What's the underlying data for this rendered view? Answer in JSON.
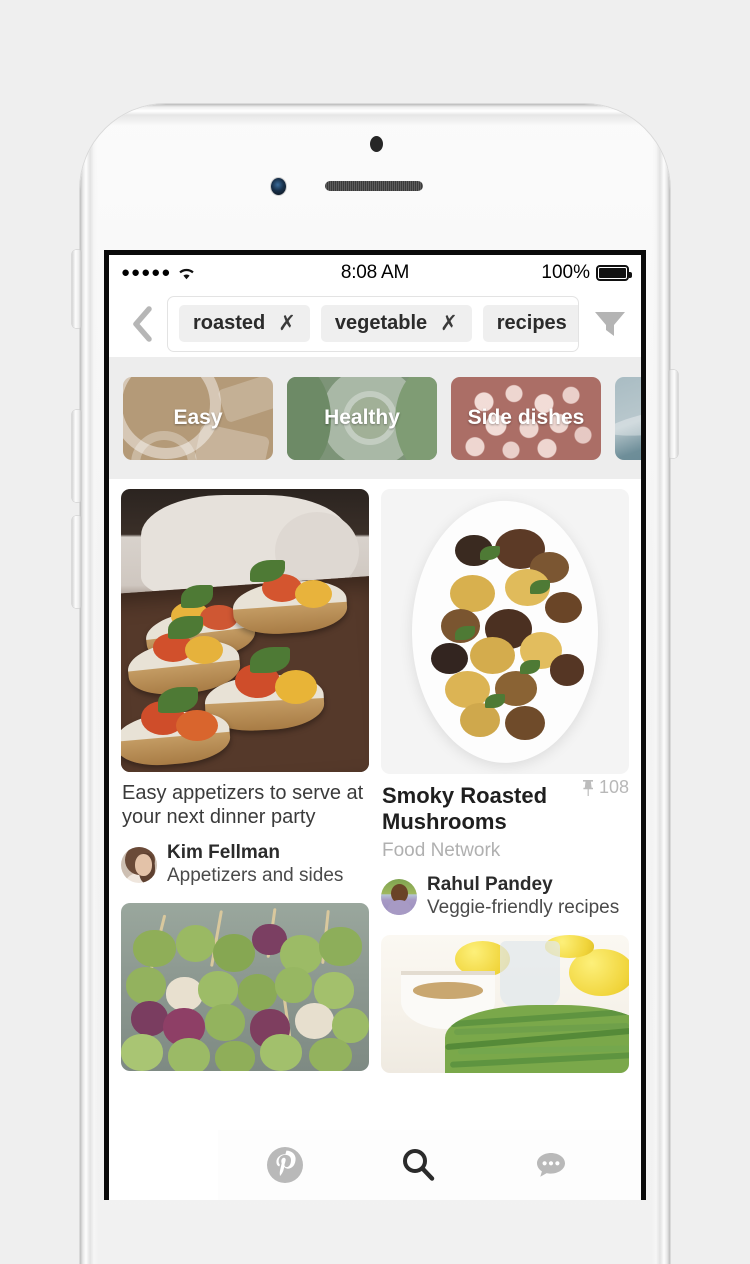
{
  "device": {
    "name": "iphone-white-silver",
    "body_color": "#f4f4f4",
    "bezel_color": "#ffffff"
  },
  "status_bar": {
    "signal_icon": "signal-dots-icon",
    "signal_dots": "●●●●●",
    "wifi_icon": "wifi-icon",
    "time": "8:08 AM",
    "battery_percent": "100%",
    "battery_icon": "battery-full-icon"
  },
  "search_header": {
    "back_icon": "chevron-left-icon",
    "filter_icon": "filter-funnel-icon",
    "chips": [
      {
        "label": "roasted",
        "remove_icon": "close-x-icon"
      },
      {
        "label": "vegetable",
        "remove_icon": "close-x-icon"
      },
      {
        "label": "recipes",
        "remove_icon": "close-x-icon"
      }
    ]
  },
  "categories": [
    {
      "label": "Easy",
      "accent": "#b49a78"
    },
    {
      "label": "Healthy",
      "accent": "#7d9478"
    },
    {
      "label": "Side dishes",
      "accent": "#ab6e66"
    },
    {
      "label": "",
      "accent": "#6e8e99"
    }
  ],
  "feed": {
    "left_column": [
      {
        "image_name": "bruschetta-appetizers-photo",
        "title": "Easy appetizers to serve at your next dinner party",
        "source": "",
        "pin_count": "",
        "user": {
          "name": "Kim Fellman",
          "board": "Appetizers and sides",
          "avatar_name": "avatar-kim-fellman"
        }
      },
      {
        "image_name": "brussels-sprout-skewers-photo",
        "title": "",
        "source": "",
        "pin_count": "",
        "user": {
          "name": "",
          "board": "",
          "avatar_name": ""
        }
      }
    ],
    "right_column": [
      {
        "image_name": "smoky-roasted-mushrooms-photo",
        "title": "Smoky Roasted Mushrooms",
        "source": "Food Network",
        "pin_count": "108",
        "pin_count_icon": "pushpin-icon",
        "user": {
          "name": "Rahul Pandey",
          "board": "Veggie-friendly recipes",
          "avatar_name": "avatar-rahul-pandey"
        }
      },
      {
        "image_name": "asparagus-almonds-lemon-photo",
        "title": "",
        "source": "",
        "pin_count": "",
        "user": {
          "name": "",
          "board": "",
          "avatar_name": ""
        }
      }
    ]
  },
  "tab_bar": {
    "tabs": [
      {
        "id": "home",
        "icon": "pinterest-logo-icon",
        "active": false
      },
      {
        "id": "search",
        "icon": "search-magnifier-icon",
        "active": true
      },
      {
        "id": "messages",
        "icon": "chat-bubble-icon",
        "active": false
      },
      {
        "id": "profile",
        "icon": "person-icon",
        "active": false
      }
    ]
  },
  "colors": {
    "page_background": "#efefef",
    "chip_background": "#efefef",
    "category_strip": "#ededed",
    "muted_text": "#b0b0b0",
    "icon_gray": "#b4b4b4"
  }
}
